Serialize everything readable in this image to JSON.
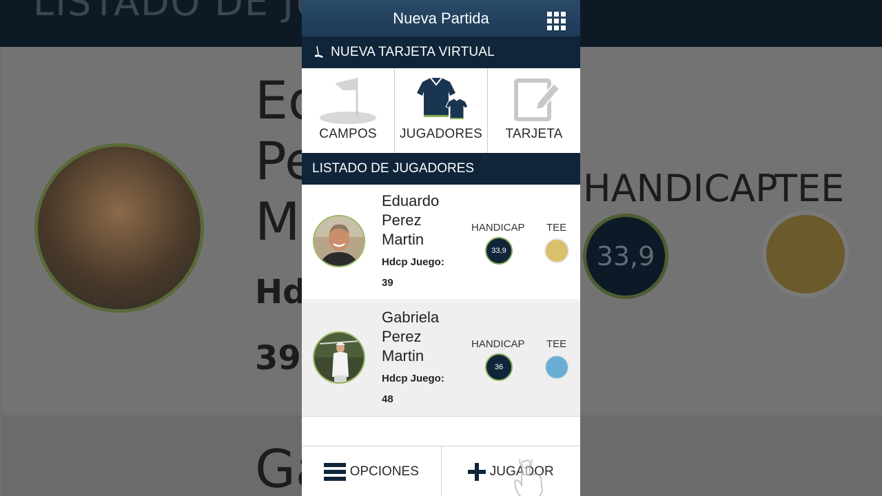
{
  "app": {
    "title": "Nueva Partida",
    "menu_icon": "grid-icon"
  },
  "subheader": {
    "icon": "golf-putter-icon",
    "label": "NUEVA TARJETA VIRTUAL"
  },
  "tabs": [
    {
      "label": "CAMPOS",
      "icon": "golf-flag-icon"
    },
    {
      "label": "JUGADORES",
      "icon": "polo-shirts-icon"
    },
    {
      "label": "TARJETA",
      "icon": "edit-card-icon"
    }
  ],
  "section": {
    "title": "LISTADO DE JUGADORES"
  },
  "players": [
    {
      "name_lines": [
        "Eduardo",
        "Perez",
        "Martin"
      ],
      "hdcp_juego_label": "Hdcp Juego:",
      "hdcp_juego_value": "39",
      "handicap_label": "HANDICAP",
      "handicap_value": "33,9",
      "tee_label": "TEE",
      "tee_color": "#d9c06a"
    },
    {
      "name_lines": [
        "Gabriela",
        "Perez",
        "Martin"
      ],
      "hdcp_juego_label": "Hdcp Juego:",
      "hdcp_juego_value": "48",
      "handicap_label": "HANDICAP",
      "handicap_value": "36",
      "tee_label": "TEE",
      "tee_color": "#6aaed6"
    }
  ],
  "bottom": {
    "options_label": "OPCIONES",
    "add_player_label": "JUGADOR"
  },
  "background": {
    "header_text": "LISTADO DE JUGADORES",
    "name_lines": [
      "Ed",
      "Pe",
      "M"
    ],
    "hdcp": "Hdc",
    "hdcp_value": "39",
    "handicap_label": "HANDICAP",
    "tee_label": "TEE",
    "handicap_value": "33,9",
    "next_name": "Ga"
  },
  "colors": {
    "navy": "#10253a",
    "accent_green": "#8caf56"
  }
}
